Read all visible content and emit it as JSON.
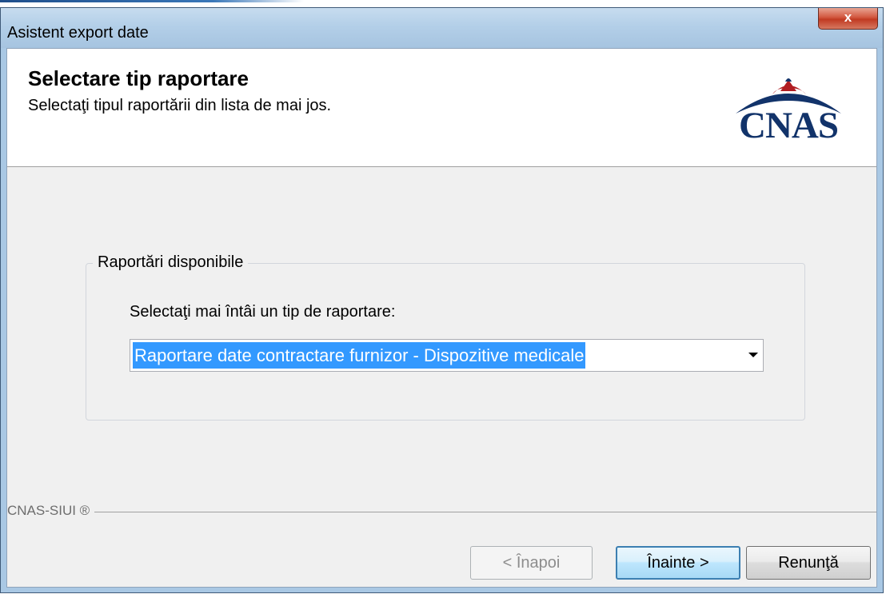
{
  "window": {
    "title": "Asistent export date",
    "close_label": "x"
  },
  "header": {
    "title": "Selectare tip raportare",
    "subtitle": "Selectaţi tipul raportării din lista de mai jos.",
    "logo_text": "CNAS"
  },
  "group": {
    "legend": "Raportări disponibile",
    "prompt": "Selectaţi mai întâi un tip de raportare:",
    "combo_value": "Raportare date contractare furnizor - Dispozitive medicale"
  },
  "footer": {
    "label": "CNAS-SIUI ®",
    "back_label": "< Înapoi",
    "next_label": "Înainte >",
    "cancel_label": "Renunţă"
  },
  "colors": {
    "selection": "#3399ff",
    "logo_blue": "#12336a",
    "logo_red": "#b01d22",
    "title_bar": "#b3cfe8"
  },
  "icons": {
    "close": "close-icon",
    "dropdown": "chevron-down-icon",
    "logo": "cnas-logo"
  }
}
